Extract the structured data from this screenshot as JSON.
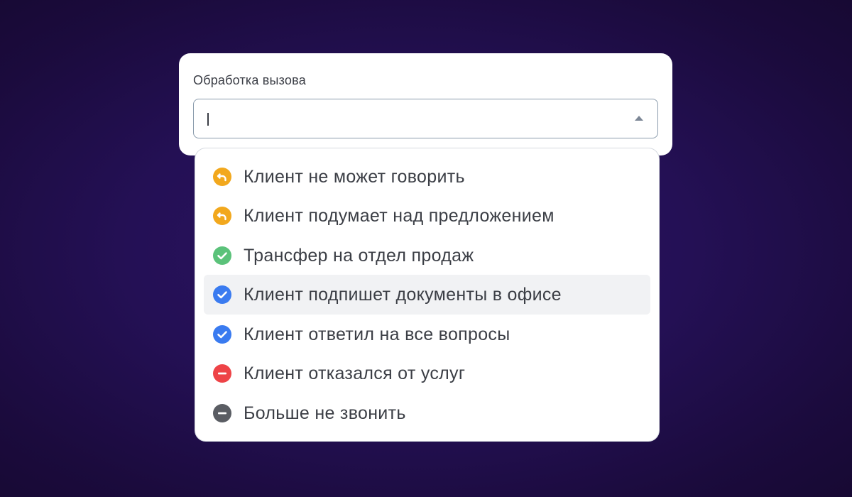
{
  "field": {
    "label": "Обработка вызова",
    "value": "",
    "placeholder": ""
  },
  "options": [
    {
      "label": "Клиент не может говорить",
      "icon": "callback-icon",
      "color": "#F2A81D",
      "highlighted": false
    },
    {
      "label": "Клиент подумает над предложением",
      "icon": "callback-icon",
      "color": "#F2A81D",
      "highlighted": false
    },
    {
      "label": "Трансфер на отдел продаж",
      "icon": "check-circle-icon",
      "color": "#5BC27A",
      "highlighted": false
    },
    {
      "label": "Клиент подпишет документы в офисе",
      "icon": "check-circle-icon",
      "color": "#3A7BF0",
      "highlighted": true
    },
    {
      "label": "Клиент ответил на все вопросы",
      "icon": "check-circle-icon",
      "color": "#3A7BF0",
      "highlighted": false
    },
    {
      "label": "Клиент отказался от услуг",
      "icon": "minus-circle-icon",
      "color": "#EE4347",
      "highlighted": false
    },
    {
      "label": "Больше не звонить",
      "icon": "minus-circle-icon",
      "color": "#5A5D63",
      "highlighted": false
    }
  ]
}
